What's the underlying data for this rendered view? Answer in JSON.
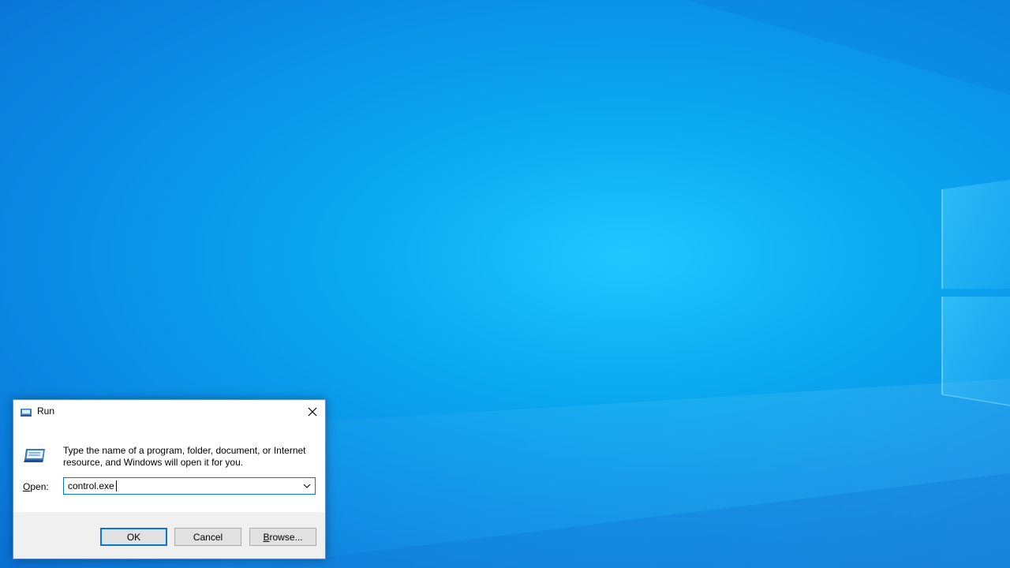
{
  "desktop": {
    "wallpaper": "Windows 10 hero wallpaper",
    "accent_color": "#0a8ee6"
  },
  "run_dialog": {
    "title": "Run",
    "close_icon": "close-icon",
    "app_icon": "run-icon",
    "description": "Type the name of a program, folder, document, or Internet resource, and Windows will open it for you.",
    "open_label_accel": "O",
    "open_label_rest": "pen:",
    "open_value": "control.exe",
    "dropdown_icon": "chevron-down-icon",
    "buttons": {
      "ok": "OK",
      "cancel": "Cancel",
      "browse_accel": "B",
      "browse_rest": "rowse..."
    },
    "focus_color": "#0078d7"
  }
}
